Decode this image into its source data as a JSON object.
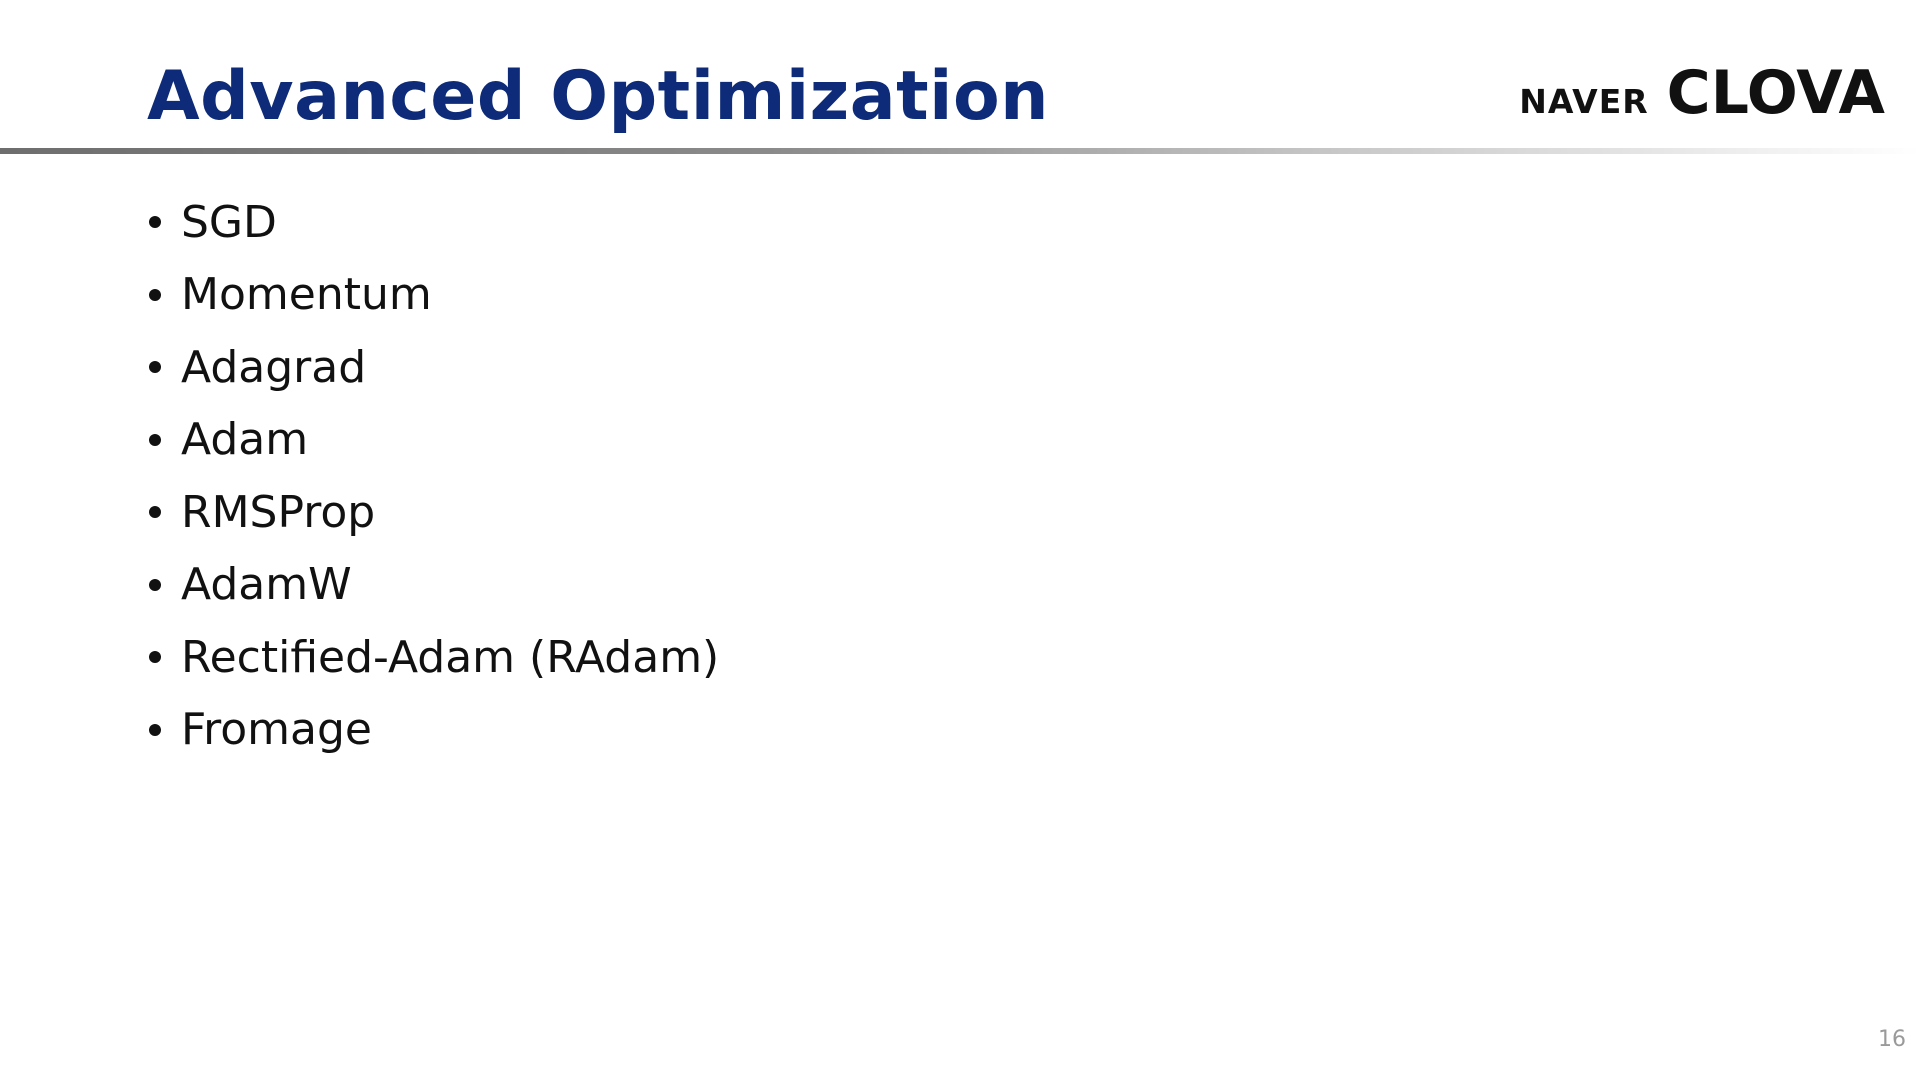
{
  "slide": {
    "title": "Advanced Optimization",
    "logo": {
      "naver": "NAVER",
      "clova": "CLOVA"
    },
    "bullets": [
      "SGD",
      "Momentum",
      "Adagrad",
      "Adam",
      "RMSProp",
      "AdamW",
      "Rectified-Adam (RAdam)",
      "Fromage"
    ],
    "page_number": "16"
  },
  "colors": {
    "title": "#0d2b78",
    "text": "#111111",
    "page_number": "#9a9a9a",
    "rule": "#6e6e6e"
  }
}
